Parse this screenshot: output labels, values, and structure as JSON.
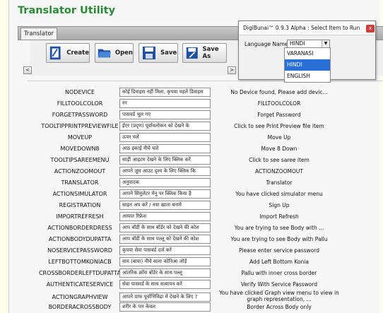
{
  "app": {
    "title": "Translator Utility"
  },
  "tabs": [
    {
      "label": "Translator"
    }
  ],
  "toolbar": {
    "create_label": "Create",
    "open_label": "Open",
    "save_label": "Save",
    "save_as_label": "Save As",
    "left_arrow": "<",
    "right_arrow": ">"
  },
  "rows": [
    {
      "key": "NODEVICE",
      "hindi": "कोई डिवाइस नहीं मिला, कृपया पहले डिवाइस",
      "english": "No Device found, Please add devic..."
    },
    {
      "key": "FILLTOOLCOLOR",
      "hindi": "रंग",
      "english": "FILLTOOLCOLOR"
    },
    {
      "key": "FORGETPASSWORD",
      "hindi": "पासवर्ड भूल गए",
      "english": "Forget Password"
    },
    {
      "key": "TOOLTIPPRINTPREVIEWFILE",
      "hindi": "ईएर (प्रदृण) पूर्वावलोकन को देखने के",
      "english": "Click to see Print Preview file item"
    },
    {
      "key": "MOVEUP",
      "hindi": "ऊपर चलें",
      "english": "Move Up"
    },
    {
      "key": "MOVEDOWN8",
      "hindi": "आठ इकाई नीचे चलें",
      "english": "Move 8 Down"
    },
    {
      "key": "TOOLTIPSAREEMENU",
      "hindi": "साड़ी आइटम देखने के लिए क्लिक करें",
      "english": "Click to see saree item"
    },
    {
      "key": "ACTIONZOOMOUT",
      "hindi": "आपने ज़ूम आउट दृश्य के लिए क्लिक कि",
      "english": "ACTIONZOOMOUT"
    },
    {
      "key": "TRANSLATOR",
      "hindi": "अनुवादक",
      "english": "Translator"
    },
    {
      "key": "ACTIONSIMULATOR",
      "hindi": "आपने सिमुलेटर मेनू पर क्लिक किया है",
      "english": "You have clicked simulator menu"
    },
    {
      "key": "REGISTRATION",
      "hindi": "साइन अप करें / नया खाता बनाये",
      "english": "Sign Up"
    },
    {
      "key": "IMPORTREFRESH",
      "hindi": "आयात रिफ्रेश",
      "english": "Import Refresh"
    },
    {
      "key": "ACTIONBORDERDRESS",
      "hindi": "आप बॉडी के साथ बॉर्डर को देखने की कोश",
      "english": "You are trying to see Body with ..."
    },
    {
      "key": "ACTIONBODYDUPATTA",
      "hindi": "आप बॉडी के साथ पल्लू को देखने की कोश",
      "english": "You are trying to see Body with Pallu"
    },
    {
      "key": "NOSERVICEPASSWORD",
      "hindi": "कृपया सेवा पासवर्ड दर्ज करें",
      "english": "Please enter service password"
    },
    {
      "key": "LEFTBOTTOMKONIACB",
      "hindi": "वाम (बाया) नीचे वाला कोनिआ जोड़ें",
      "english": "Add Left Bottom Konia"
    },
    {
      "key": "CROSSBORDERLEFTDUPATTA",
      "hindi": "आंतरिक क्रॉस बॉर्डर के साथ पल्लू",
      "english": "Pallu with inner cross border"
    },
    {
      "key": "AUTHENTICATESERVICE",
      "hindi": "सेवा पासवर्ड के साथ सत्यापन करें",
      "english": "Verify With Service Password"
    },
    {
      "key": "ACTIONGRAPHVIEW",
      "hindi": "आपने ग्राफ पूर्वाभिविद्रा में देखने के लिए ?",
      "english": "You have clicked Graph view menu to view in graph representation, ..."
    },
    {
      "key": "BORDERACROSSBODY",
      "hindi": "शरीर के पार केवल",
      "english": "Border Across Body only"
    }
  ],
  "popup": {
    "title": "DigiBunai™ 0.9.3 Alpha : Select Item to  Run",
    "close_glyph": "x",
    "language_label": "Language Name",
    "selected_language": "HINDI",
    "options": [
      "VARANASI",
      "HINDI",
      "ENGLISH"
    ],
    "highlighted_option": "HINDI"
  },
  "colors": {
    "title_green": "#2c8a37",
    "selection_blue": "#2a6fd6",
    "close_red": "#c9403a"
  }
}
